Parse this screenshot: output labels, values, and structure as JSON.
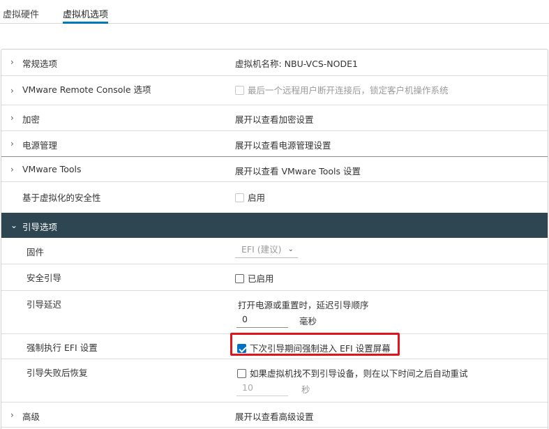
{
  "tabs": [
    {
      "label": "虚拟硬件"
    },
    {
      "label": "虚拟机选项"
    }
  ],
  "rows": {
    "general": {
      "label": "常规选项",
      "value": "虚拟机名称: NBU-VCS-NODE1"
    },
    "vmrc": {
      "label": "VMware Remote Console 选项",
      "value": "最后一个远程用户断开连接后，锁定客户机操作系统"
    },
    "encryption": {
      "label": "加密",
      "value": "展开以查看加密设置"
    },
    "power": {
      "label": "电源管理",
      "value": "展开以查看电源管理设置"
    },
    "tools": {
      "label": "VMware Tools",
      "value": "展开以查看 VMware Tools 设置"
    },
    "vbs": {
      "label": "基于虚拟化的安全性",
      "value": "启用"
    },
    "boot": {
      "label": "引导选项",
      "firmware": {
        "label": "固件",
        "value": "EFI (建议)"
      },
      "secure_boot": {
        "label": "安全引导",
        "value": "已启用"
      },
      "boot_delay": {
        "label": "引导延迟",
        "description": "打开电源或重置时，延迟引导顺序",
        "value": "0",
        "unit": "毫秒"
      },
      "force_efi": {
        "label": "强制执行 EFI 设置",
        "value": "下次引导期间强制进入 EFI 设置屏幕"
      },
      "failed_boot": {
        "label": "引导失败后恢复",
        "value": "如果虚拟机找不到引导设备，则在以下时间之后自动重试",
        "seconds": "10",
        "unit": "秒"
      }
    },
    "advanced": {
      "label": "高级",
      "value": "展开以查看高级设置"
    }
  },
  "icons": {
    "collapsed": "chevron-right-icon",
    "expanded": "chevron-down-icon"
  },
  "colors": {
    "accent": "#0079b8",
    "header_bg": "#2e4552",
    "highlight": "#e0151b",
    "checkbox": "#0072c6"
  }
}
